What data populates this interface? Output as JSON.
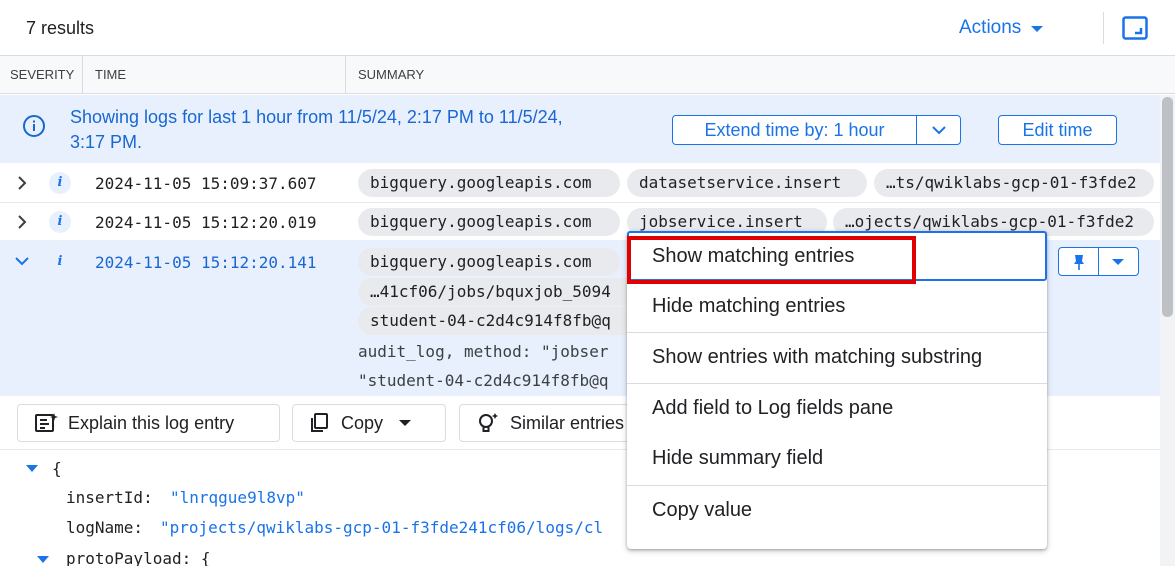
{
  "header": {
    "results": "7 results",
    "actions_label": "Actions",
    "expand_icon": "fullscreen-icon"
  },
  "columns": {
    "severity": "SEVERITY",
    "time": "TIME",
    "summary": "SUMMARY"
  },
  "banner": {
    "icon": "info-icon",
    "text_line1": "Showing logs for last 1 hour from 11/5/24, 2:17 PM to 11/5/24,",
    "text_line2": "3:17 PM.",
    "extend_label": "Extend time by: 1 hour",
    "edit_label": "Edit time"
  },
  "rows": [
    {
      "severity": "i",
      "time": "2024-11-05 15:09:37.607",
      "chips": [
        "bigquery.googleapis.com",
        "datasetservice.insert",
        "…ts/qwiklabs-gcp-01-f3fde2"
      ]
    },
    {
      "severity": "i",
      "time": "2024-11-05 15:12:20.019",
      "chips": [
        "bigquery.googleapis.com",
        "jobservice.insert",
        "…ojects/qwiklabs-gcp-01-f3fde2"
      ]
    },
    {
      "severity": "i",
      "time": "2024-11-05 15:12:20.141",
      "chips": [
        "bigquery.googleapis.com",
        "…41cf06/jobs/bquxjob_5094",
        "student-04-c2d4c914f8fb@q"
      ],
      "summary_line1": "audit_log, method: \"jobser",
      "summary_line2": "\"student-04-c2d4c914f8fb@q"
    }
  ],
  "entry_toolbar": {
    "explain": "Explain this log entry",
    "copy": "Copy",
    "similar": "Similar entries"
  },
  "json_view": {
    "open_brace": "{",
    "insert_id_key": "insertId:",
    "insert_id_value": "\"lnrqgue9l8vp\"",
    "log_name_key": "logName:",
    "log_name_value": "\"projects/qwiklabs-gcp-01-f3fde241cf06/logs/cl",
    "proto_key": "protoPayload: {"
  },
  "context_menu": {
    "items": [
      "Show matching entries",
      "Hide matching entries",
      "Show entries with matching substring",
      "Add field to Log fields pane",
      "Hide summary field",
      "Copy value"
    ]
  },
  "colors": {
    "accent": "#1a73e8",
    "banner_bg": "#e8f0fe",
    "highlight": "#e00000"
  }
}
